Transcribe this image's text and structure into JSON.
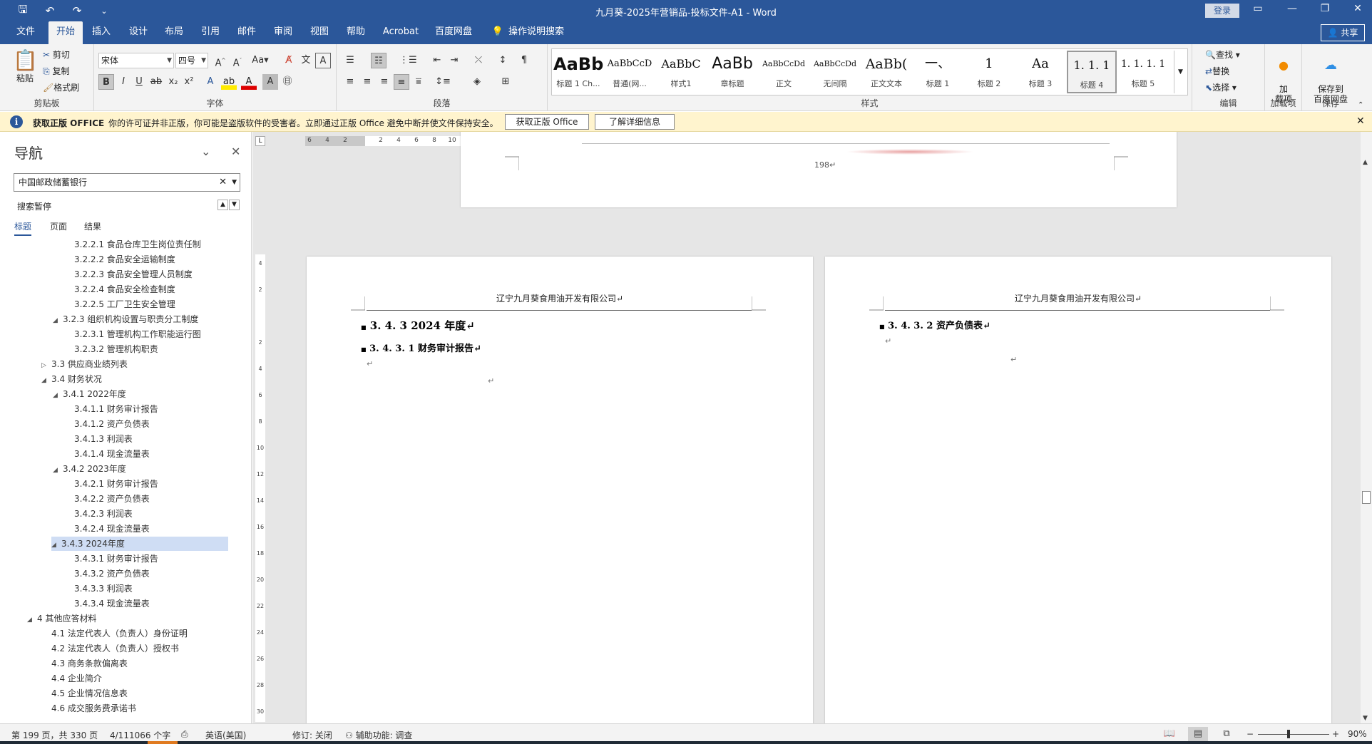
{
  "window": {
    "title": "九月葵-2025年营销品-投标文件-A1  -  Word",
    "login": "登录",
    "qat": [
      "save-icon",
      "undo-icon",
      "redo-icon",
      "customize-icon"
    ]
  },
  "tabs": [
    "文件",
    "开始",
    "插入",
    "设计",
    "布局",
    "引用",
    "邮件",
    "审阅",
    "视图",
    "帮助",
    "Acrobat",
    "百度网盘",
    "操作说明搜索"
  ],
  "active_tab": "开始",
  "share": "共享",
  "ribbon": {
    "clipboard": {
      "paste": "粘贴",
      "cut": "剪切",
      "copy": "复制",
      "format_painter": "格式刷",
      "label": "剪贴板"
    },
    "font": {
      "name": "宋体",
      "size": "四号",
      "label": "字体"
    },
    "paragraph": {
      "label": "段落"
    },
    "styles": {
      "label": "样式",
      "items": [
        {
          "preview": "AaBb",
          "name": "标题 1 Ch..."
        },
        {
          "preview": "AaBbCcD",
          "name": "普通(网..."
        },
        {
          "preview": "AaBbC",
          "name": "样式1"
        },
        {
          "preview": "AaBb",
          "name": "章标题"
        },
        {
          "preview": "AaBbCcDd",
          "name": "正文"
        },
        {
          "preview": "AaBbCcDd",
          "name": "无间隔"
        },
        {
          "preview": "AaBb(",
          "name": "正文文本"
        },
        {
          "preview": "一、",
          "name": "标题 1"
        },
        {
          "preview": "1",
          "name": "标题 2"
        },
        {
          "preview": "Aa",
          "name": "标题 3"
        },
        {
          "preview": "1. 1. 1",
          "name": "标题 4"
        },
        {
          "preview": "1. 1. 1. 1",
          "name": "标题 5"
        }
      ],
      "selected_index": 10
    },
    "editing": {
      "find": "查找",
      "replace": "替换",
      "select": "选择",
      "label": "编辑"
    },
    "addins": {
      "btn": "加\n载项",
      "label": "加载项"
    },
    "save": {
      "btn": "保存到\n百度网盘",
      "label": "保存"
    }
  },
  "warning": {
    "title": "获取正版 OFFICE",
    "message": "你的许可证并非正版，你可能是盗版软件的受害者。立即通过正版 Office 避免中断并使文件保持安全。",
    "btn1": "获取正版 Office",
    "btn2": "了解详细信息"
  },
  "nav": {
    "title": "导航",
    "search_value": "中国邮政储蓄银行",
    "status": "搜索暂停",
    "tabs": [
      "标题",
      "页面",
      "结果"
    ],
    "items": [
      {
        "text": "3.2.2.1 食品仓库卫生岗位责任制",
        "level": 3,
        "tw": ""
      },
      {
        "text": "3.2.2.2 食品安全运输制度",
        "level": 3,
        "tw": ""
      },
      {
        "text": "3.2.2.3 食品安全管理人员制度",
        "level": 3,
        "tw": ""
      },
      {
        "text": "3.2.2.4 食品安全检查制度",
        "level": 3,
        "tw": ""
      },
      {
        "text": "3.2.2.5 工厂卫生安全管理",
        "level": 3,
        "tw": ""
      },
      {
        "text": "3.2.3 组织机构设置与职责分工制度",
        "level": 2,
        "tw": "◢"
      },
      {
        "text": "3.2.3.1 管理机构工作职能运行图",
        "level": 3,
        "tw": ""
      },
      {
        "text": "3.2.3.2 管理机构职责",
        "level": 3,
        "tw": ""
      },
      {
        "text": "3.3 供应商业绩列表",
        "level": 1,
        "tw": "▷"
      },
      {
        "text": "3.4 财务状况",
        "level": 1,
        "tw": "◢"
      },
      {
        "text": "3.4.1 2022年度",
        "level": 2,
        "tw": "◢"
      },
      {
        "text": "3.4.1.1 财务审计报告",
        "level": 3,
        "tw": ""
      },
      {
        "text": "3.4.1.2 资产负债表",
        "level": 3,
        "tw": ""
      },
      {
        "text": "3.4.1.3 利润表",
        "level": 3,
        "tw": ""
      },
      {
        "text": "3.4.1.4 现金流量表",
        "level": 3,
        "tw": ""
      },
      {
        "text": "3.4.2 2023年度",
        "level": 2,
        "tw": "◢"
      },
      {
        "text": "3.4.2.1 财务审计报告",
        "level": 3,
        "tw": ""
      },
      {
        "text": "3.4.2.2 资产负债表",
        "level": 3,
        "tw": ""
      },
      {
        "text": "3.4.2.3 利润表",
        "level": 3,
        "tw": ""
      },
      {
        "text": "3.4.2.4 现金流量表",
        "level": 3,
        "tw": ""
      },
      {
        "text": "3.4.3 2024年度",
        "level": 2,
        "tw": "◢",
        "selected": true
      },
      {
        "text": "3.4.3.1 财务审计报告",
        "level": 3,
        "tw": ""
      },
      {
        "text": "3.4.3.2 资产负债表",
        "level": 3,
        "tw": ""
      },
      {
        "text": "3.4.3.3 利润表",
        "level": 3,
        "tw": ""
      },
      {
        "text": "3.4.3.4 现金流量表",
        "level": 3,
        "tw": ""
      },
      {
        "text": "4 其他应答材料",
        "level": 0,
        "tw": "◢"
      },
      {
        "text": "4.1 法定代表人（负责人）身份证明",
        "level": 1,
        "tw": ""
      },
      {
        "text": "4.2 法定代表人（负责人）授权书",
        "level": 1,
        "tw": ""
      },
      {
        "text": "4.3 商务条款偏离表",
        "level": 1,
        "tw": ""
      },
      {
        "text": "4.4 企业简介",
        "level": 1,
        "tw": ""
      },
      {
        "text": "4.5 企业情况信息表",
        "level": 1,
        "tw": ""
      },
      {
        "text": "4.6 成交服务费承诺书",
        "level": 1,
        "tw": ""
      }
    ]
  },
  "document": {
    "page_number": "198↵",
    "left_page": {
      "header": "辽宁九月葵食用油开发有限公司↵",
      "h1": "3. 4. 3 2024 年度↵",
      "h2": "3. 4. 3. 1 财务审计报告↵"
    },
    "right_page": {
      "header": "辽宁九月葵食用油开发有限公司↵",
      "h2": "3. 4. 3. 2 资产负债表↵"
    },
    "para_mark": "↵"
  },
  "statusbar": {
    "page": "第 199 页，共 330 页",
    "words": "4/111066 个字",
    "lang": "英语(美国)",
    "track": "修订: 关闭",
    "accessibility": "辅助功能: 调查",
    "zoom": "90%"
  }
}
